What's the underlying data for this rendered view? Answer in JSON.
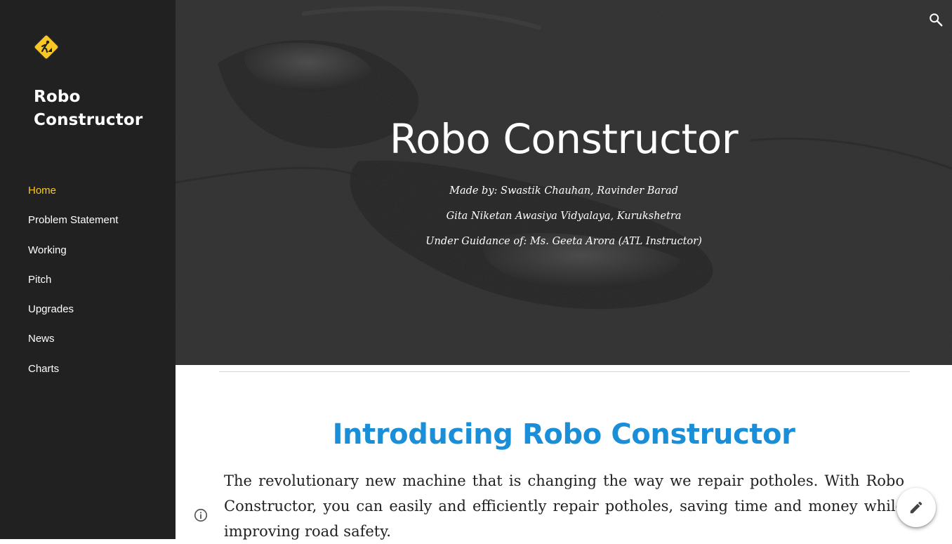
{
  "sidebar": {
    "site_title": "Robo Constructor",
    "logo_icon": "road-work-sign-icon",
    "nav": [
      {
        "label": "Home",
        "active": true
      },
      {
        "label": "Problem Statement",
        "active": false
      },
      {
        "label": "Working",
        "active": false
      },
      {
        "label": "Pitch",
        "active": false
      },
      {
        "label": "Upgrades",
        "active": false
      },
      {
        "label": "News",
        "active": false
      },
      {
        "label": "Charts",
        "active": false
      }
    ]
  },
  "hero": {
    "title": "Robo Constructor",
    "lines": [
      "Made by: Swastik Chauhan, Ravinder Barad",
      "Gita Niketan Awasiya Vidyalaya, Kurukshetra",
      "Under Guidance of: Ms. Geeta Arora (ATL Instructor)"
    ],
    "search_icon": "search-icon"
  },
  "main": {
    "heading": "Introducing Robo Constructor",
    "paragraph": "The revolutionary new machine that is changing the way we repair potholes. With Robo Constructor, you can easily and efficiently repair potholes, saving time and money while improving road safety."
  },
  "floating": {
    "info_icon": "info-icon",
    "edit_icon": "pencil-icon"
  },
  "colors": {
    "sidebar_bg": "#212121",
    "active_nav": "#f9c825",
    "heading_blue": "#1a8fd8"
  }
}
